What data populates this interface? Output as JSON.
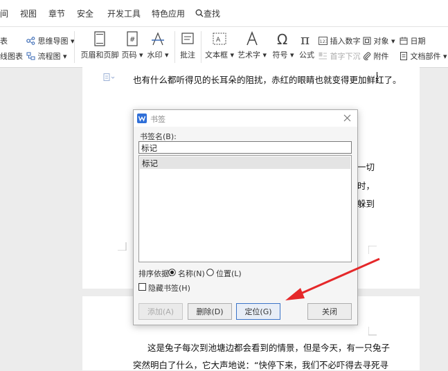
{
  "menubar": {
    "items": [
      "间",
      "视图",
      "章节",
      "安全",
      "开发工具",
      "特色应用"
    ],
    "search_label": "查找"
  },
  "ribbon": {
    "left_row1": "表",
    "left_row2": "线图表",
    "mindmap": "思维导图",
    "flowchart": "流程图",
    "header_footer": "页眉和页脚",
    "page_number": "页码",
    "watermark": "水印",
    "comment": "批注",
    "textbox": "文本框",
    "art_text": "艺术字",
    "symbol": "符号",
    "formula": "公式",
    "insert_number": "插入数字",
    "object": "对象",
    "date": "日期",
    "first_letter_sink": "首字下沉",
    "attachment": "附件",
    "doc_parts": "文档部件"
  },
  "document": {
    "page1_top": "也有什么都听得见的长耳朵的阻扰，赤红的眼睛也就变得更加鲜红了。",
    "hidden_partial": "一切",
    "hidden_partial2": "时，",
    "hidden_partial3": "躲到",
    "page2_line1": "这是兔子每次到池塘边都会看到的情景，但是今天，有一只兔子",
    "page2_line2": "突然明白了什么，它大声地说：“快停下来，我们不必吓得去寻死寻"
  },
  "dialog": {
    "title": "书签",
    "name_label": "书签名(B):",
    "name_value": "标记",
    "list_items": [
      "标记"
    ],
    "sort_label": "排序依据:",
    "sort_name": "名称(N)",
    "sort_position": "位置(L)",
    "hidden_bookmark": "隐藏书签(H)",
    "btn_add": "添加(A)",
    "btn_delete": "删除(D)",
    "btn_goto": "定位(G)",
    "btn_close": "关闭"
  },
  "colors": {
    "arrow": "#e5282a",
    "dialog_icon": "#2f6fd8",
    "selection": "#e4e4e4"
  }
}
